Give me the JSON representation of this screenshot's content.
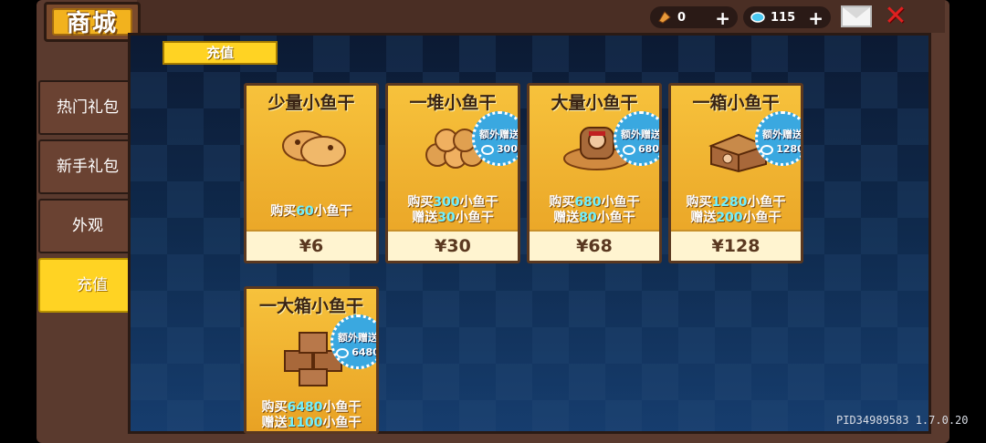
{
  "header": {
    "title": "商城"
  },
  "currency": [
    {
      "icon": "fish-coin-icon",
      "value": "0"
    },
    {
      "icon": "gem-icon",
      "value": "115"
    }
  ],
  "sidebar": {
    "items": [
      {
        "label": "热门礼包"
      },
      {
        "label": "新手礼包"
      },
      {
        "label": "外观"
      },
      {
        "label": "充值"
      }
    ]
  },
  "section": {
    "label": "充值"
  },
  "cards": [
    {
      "name": "少量小鱼干",
      "buy_prefix": "购买",
      "buy_amount": "60",
      "buy_suffix": "小鱼干",
      "price": "¥6"
    },
    {
      "name": "一堆小鱼干",
      "buy_prefix": "购买",
      "buy_amount": "300",
      "buy_suffix": "小鱼干",
      "gift_prefix": "赠送",
      "gift_amount": "30",
      "gift_suffix": "小鱼干",
      "badge_title": "额外赠送",
      "badge_value": "300",
      "price": "¥30"
    },
    {
      "name": "大量小鱼干",
      "buy_prefix": "购买",
      "buy_amount": "680",
      "buy_suffix": "小鱼干",
      "gift_prefix": "赠送",
      "gift_amount": "80",
      "gift_suffix": "小鱼干",
      "badge_title": "额外赠送",
      "badge_value": "680",
      "price": "¥68"
    },
    {
      "name": "一箱小鱼干",
      "buy_prefix": "购买",
      "buy_amount": "1280",
      "buy_suffix": "小鱼干",
      "gift_prefix": "赠送",
      "gift_amount": "200",
      "gift_suffix": "小鱼干",
      "badge_title": "额外赠送",
      "badge_value": "1280",
      "price": "¥128"
    },
    {
      "name": "一大箱小鱼干",
      "buy_prefix": "购买",
      "buy_amount": "6480",
      "buy_suffix": "小鱼干",
      "gift_prefix": "赠送",
      "gift_amount": "1100",
      "gift_suffix": "小鱼干",
      "badge_title": "额外赠送",
      "badge_value": "6480"
    }
  ],
  "footer": {
    "version": "PID34989583 1.7.0.20"
  },
  "colors": {
    "accent": "#ffd323",
    "frame": "#5a3a2e",
    "card": "#f7c23c",
    "badge": "#3aa8e0",
    "highlight": "#6ff0ff"
  }
}
